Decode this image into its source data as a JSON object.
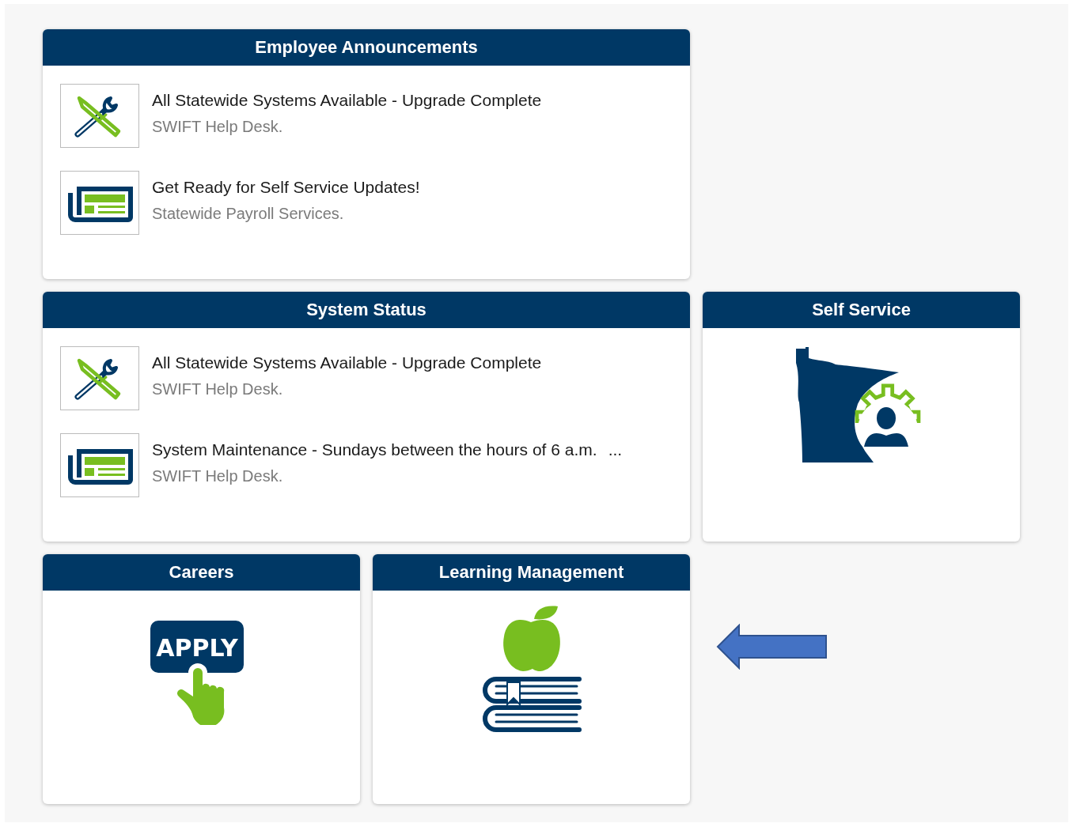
{
  "tiles": [
    {
      "kind": "list",
      "title": "Employee Announcements",
      "items": [
        {
          "kind": "tools",
          "title": "All Statewide Systems Available - Upgrade Complete",
          "source": "SWIFT Help Desk."
        },
        {
          "kind": "news",
          "title": "Get Ready for Self Service Updates!",
          "source": "Statewide Payroll Services."
        }
      ]
    },
    {
      "kind": "list",
      "title": "System Status",
      "items": [
        {
          "kind": "tools",
          "title": "All Statewide Systems Available - Upgrade Complete",
          "source": "SWIFT Help Desk."
        },
        {
          "kind": "news",
          "title": "System Maintenance - Sundays between the hours of 6 a.m.",
          "more": "...",
          "source": "SWIFT Help Desk."
        }
      ]
    },
    {
      "kind": "self-service",
      "title": "Self Service"
    },
    {
      "kind": "apply",
      "title": "Careers",
      "apply_label": "APPLY"
    },
    {
      "kind": "learning",
      "title": "Learning Management"
    }
  ]
}
